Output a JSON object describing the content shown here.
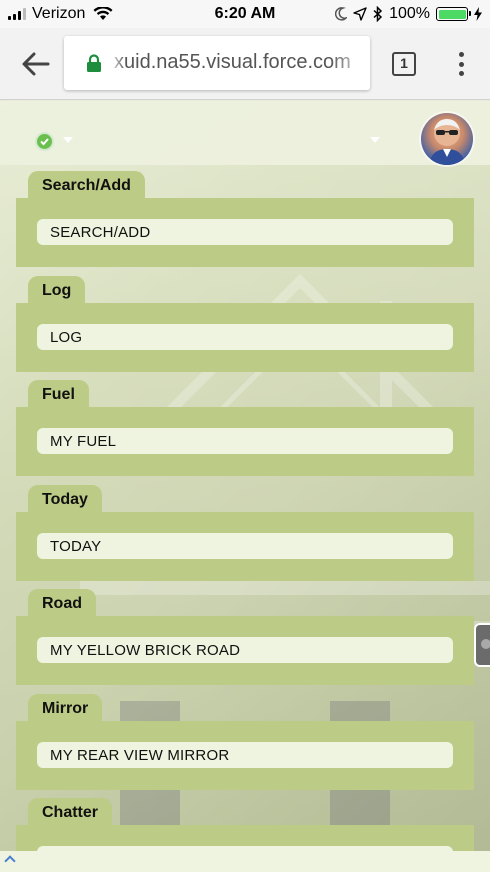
{
  "status_bar": {
    "carrier": "Verizon",
    "time": "6:20 AM",
    "battery_percent": "100%",
    "battery_level": 1.0
  },
  "browser": {
    "url": "xuid.na55.visual.force.com",
    "tab_count": "1"
  },
  "cards": [
    {
      "tab": "Search/Add",
      "field": "SEARCH/ADD"
    },
    {
      "tab": "Log",
      "field": "LOG"
    },
    {
      "tab": "Fuel",
      "field": "MY FUEL"
    },
    {
      "tab": "Today",
      "field": "TODAY"
    },
    {
      "tab": "Road",
      "field": "MY YELLOW BRICK ROAD"
    },
    {
      "tab": "Mirror",
      "field": "MY REAR VIEW MIRROR"
    },
    {
      "tab": "Chatter",
      "field": ""
    }
  ],
  "colors": {
    "card_green": "#bccb85",
    "field_bg": "#eef4e0",
    "status_ok": "#6bbf4e",
    "battery": "#4cd964"
  },
  "icons": {
    "status": "check-circle-icon",
    "back": "arrow-left-icon",
    "lock": "lock-icon",
    "menu": "more-vert-icon",
    "scroll_top": "chevron-up-icon"
  }
}
